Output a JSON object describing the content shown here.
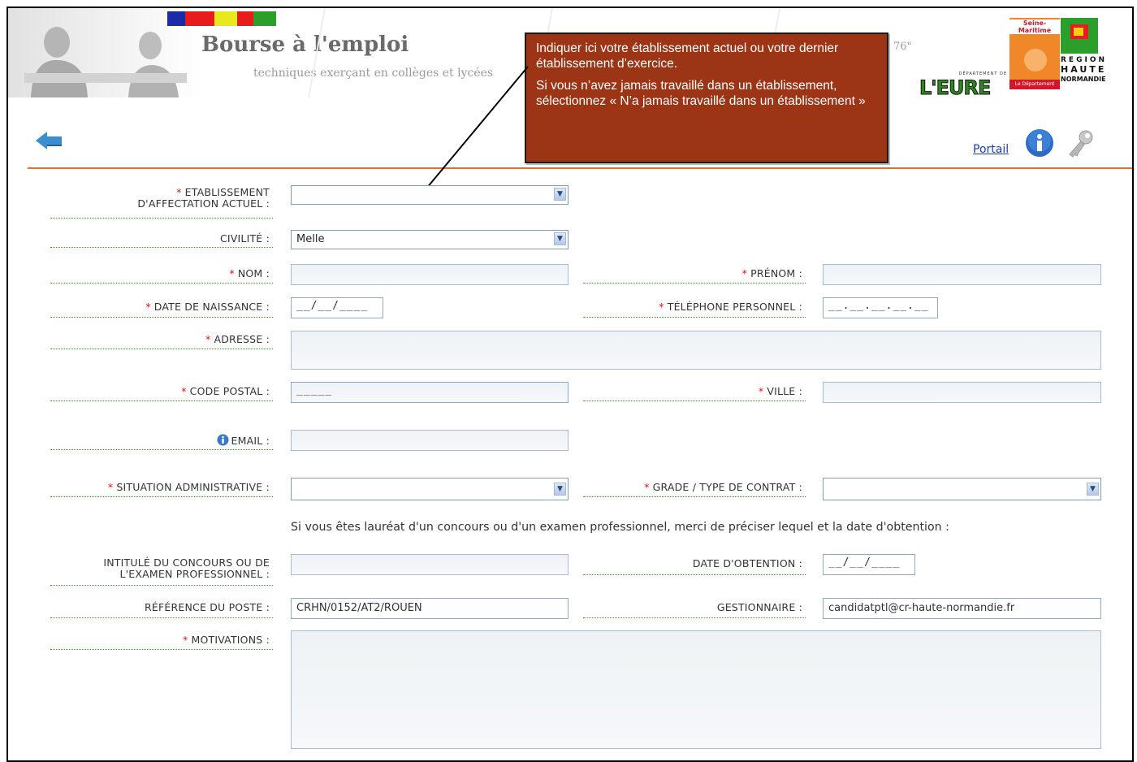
{
  "header": {
    "title": "Bourse à l'emploi",
    "subtitle": "techniques exerçant en collèges et lycées",
    "faded_ref": "76\"",
    "portal_link": "Portail",
    "color_blocks": [
      "#1a2aa8",
      "#e81c1c",
      "#e8e81c",
      "#2aa02a"
    ],
    "logos": {
      "seine_maritime": "Seine-Maritime",
      "departement": "DÉPARTEMENT DE",
      "eure": "L'EURE",
      "le_departement": "Le Département",
      "region_1": "REGION",
      "region_2": "HAUTE",
      "region_3": "NORMANDIE"
    }
  },
  "icons": {
    "back": "back-arrow-icon",
    "info": "info-icon",
    "key": "key-icon",
    "email_info": "info-icon"
  },
  "callout": {
    "line1": "Indiquer ici votre établissement actuel ou votre dernier établissement d’exercice.",
    "line2": "Si vous n’avez jamais travaillé dans un établissement, sélectionnez « N’a jamais travaillé dans un établissement »"
  },
  "form": {
    "etablissement": {
      "label_1": "ETABLISSEMENT",
      "label_2": "D'AFFECTATION ACTUEL :",
      "value": ""
    },
    "civilite": {
      "label": "CIVILITÉ :",
      "value": "Melle"
    },
    "nom": {
      "label": "NOM :",
      "value": ""
    },
    "prenom": {
      "label": "PRÉNOM :",
      "value": ""
    },
    "date_naissance": {
      "label": "DATE DE NAISSANCE :",
      "value": "__/__/____"
    },
    "telephone": {
      "label": "TÉLÉPHONE PERSONNEL :",
      "value": "__.__.__.__.__"
    },
    "adresse": {
      "label": "ADRESSE :",
      "value": ""
    },
    "code_postal": {
      "label": "CODE POSTAL :",
      "value": "_____"
    },
    "ville": {
      "label": "VILLE :",
      "value": ""
    },
    "email": {
      "label": "EMAIL :",
      "value": ""
    },
    "situation": {
      "label": "SITUATION ADMINISTRATIVE :",
      "value": ""
    },
    "grade": {
      "label": "GRADE / TYPE DE CONTRAT :",
      "value": ""
    },
    "note": "Si vous êtes lauréat d'un concours ou d'un examen professionnel, merci de préciser lequel et la date d'obtention :",
    "intitule": {
      "label_1": "INTITULÉ DU CONCOURS OU DE",
      "label_2": "L'EXAMEN PROFESSIONNEL :",
      "value": ""
    },
    "date_obtention": {
      "label": "DATE D'OBTENTION :",
      "value": "__/__/____"
    },
    "reference": {
      "label": "RÉFÉRENCE DU POSTE :",
      "value": "CRHN/0152/AT2/ROUEN"
    },
    "gestionnaire": {
      "label": "GESTIONNAIRE :",
      "value": "candidatptl@cr-haute-normandie.fr"
    },
    "motivations": {
      "label": "MOTIVATIONS :",
      "value": ""
    },
    "required_mark": "*"
  },
  "colors": {
    "callout_bg": "#9b3516",
    "header_line": "#e36c3b",
    "required": "#e01010",
    "label_underline": "#3d9a1c",
    "link": "#1a3fb0"
  }
}
